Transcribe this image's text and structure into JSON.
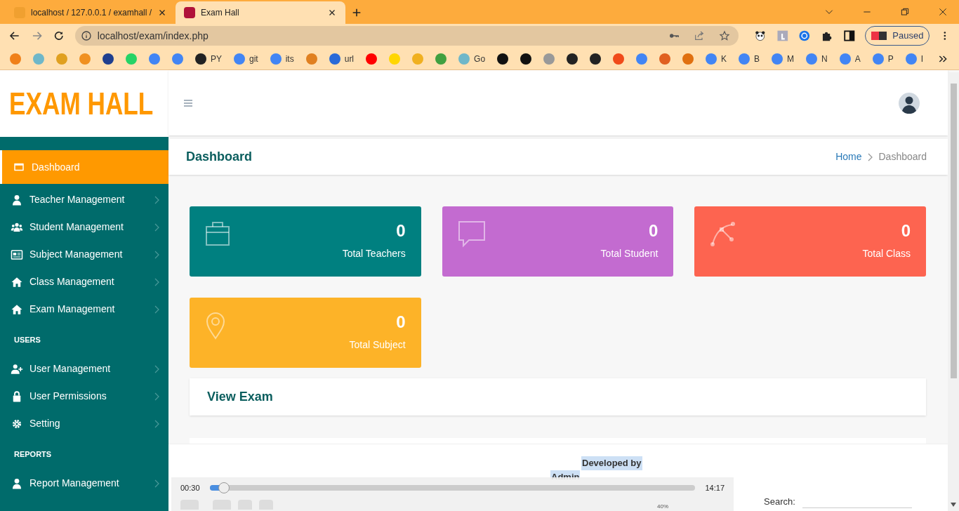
{
  "browser": {
    "tabs": [
      {
        "title": "localhost / 127.0.0.1 / examhall /",
        "selected": false
      },
      {
        "title": "Exam Hall",
        "selected": true
      }
    ],
    "address": "localhost/exam/index.php",
    "profile_button": "Paused",
    "bookmarks": [
      {
        "color": "#f0801a"
      },
      {
        "color": "#6fb7c9"
      },
      {
        "color": "#e0a020"
      },
      {
        "color": "#f09020"
      },
      {
        "color": "#1f3f8f"
      },
      {
        "color": "#25d366"
      },
      {
        "color": "#4285f4"
      },
      {
        "color": "#4285f4"
      },
      {
        "label": "PY",
        "color": "#222222"
      },
      {
        "label": "git",
        "color": "#4285f4"
      },
      {
        "label": "its",
        "color": "#4285f4"
      },
      {
        "color": "#e08020"
      },
      {
        "label": "url",
        "color": "#2a6ad8"
      },
      {
        "color": "#ff0000"
      },
      {
        "color": "#ffd600"
      },
      {
        "color": "#f0b020"
      },
      {
        "color": "#40a040"
      },
      {
        "label": "Go",
        "color": "#6fb7c9"
      },
      {
        "color": "#111111"
      },
      {
        "color": "#111111"
      },
      {
        "color": "#999999"
      },
      {
        "color": "#222222"
      },
      {
        "color": "#222222"
      },
      {
        "color": "#f04a1a"
      },
      {
        "color": "#4285f4"
      },
      {
        "color": "#e06020"
      },
      {
        "color": "#e07010"
      },
      {
        "label": "K",
        "color": "#4285f4"
      },
      {
        "label": "B",
        "color": "#4285f4"
      },
      {
        "label": "M",
        "color": "#4285f4"
      },
      {
        "label": "N",
        "color": "#4285f4"
      },
      {
        "label": "A",
        "color": "#4285f4"
      },
      {
        "label": "P",
        "color": "#4285f4"
      },
      {
        "label": "I",
        "color": "#4285f4"
      }
    ]
  },
  "logo": "EXAM HALL",
  "sidebar": {
    "items": [
      {
        "kind": "item",
        "label": "Dashboard",
        "selected": true
      },
      {
        "kind": "item",
        "label": "Teacher Management",
        "selected": false
      },
      {
        "kind": "item",
        "label": "Student Management",
        "selected": false
      },
      {
        "kind": "item",
        "label": "Subject Management",
        "selected": false
      },
      {
        "kind": "item",
        "label": "Class Management",
        "selected": false
      },
      {
        "kind": "item",
        "label": "Exam Management",
        "selected": false
      },
      {
        "kind": "heading",
        "label": "USERS"
      },
      {
        "kind": "item",
        "label": "User Management",
        "selected": false
      },
      {
        "kind": "item",
        "label": "User Permissions",
        "selected": false
      },
      {
        "kind": "item",
        "label": "Setting",
        "selected": false
      },
      {
        "kind": "heading",
        "label": "REPORTS"
      },
      {
        "kind": "item",
        "label": "Report Management",
        "selected": false
      }
    ]
  },
  "page_title": "Dashboard",
  "breadcrumb": [
    "Home",
    "Dashboard"
  ],
  "stats": [
    {
      "value": "0",
      "label": "Total Teachers",
      "color": "#008080"
    },
    {
      "value": "0",
      "label": "Total Student",
      "color": "#c36bd0"
    },
    {
      "value": "0",
      "label": "Total Class",
      "color": "#fd6450"
    },
    {
      "value": "0",
      "label": "Total Subject",
      "color": "#fdb328"
    }
  ],
  "panel_title": "View Exam",
  "search_label": "Search:",
  "footer": [
    "Developed by",
    "Admin"
  ],
  "player": {
    "elapsed": "00:30",
    "total": "14:17",
    "level": 0.03,
    "volume": "40%"
  }
}
